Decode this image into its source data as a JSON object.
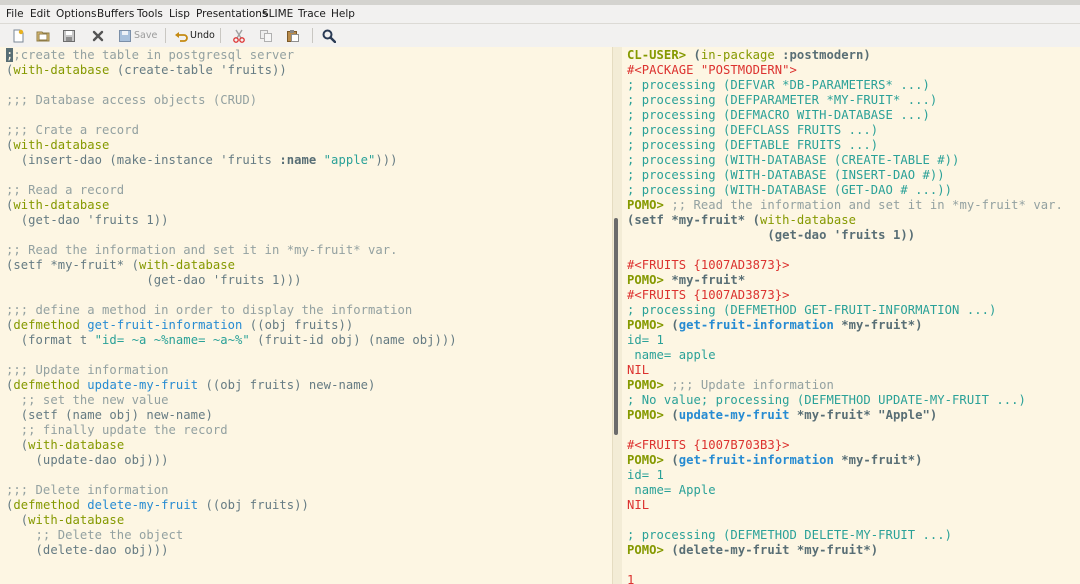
{
  "menu": [
    "File",
    "Edit",
    "Options",
    "Buffers",
    "Tools",
    "Lisp",
    "Presentations",
    "SLIME",
    "Trace",
    "Help"
  ],
  "toolbar": {
    "save_label": "Save",
    "undo_label": "Undo"
  },
  "colors": {
    "background": "#fdf6e3",
    "green": "#859900",
    "blue": "#268bd2",
    "cyan": "#2aa198",
    "red": "#dc322f",
    "comment": "#93a1a1"
  },
  "editor": {
    "lines": [
      [
        [
          "cursor",
          ";"
        ],
        [
          "cm",
          ";create the table in postgresql server"
        ]
      ],
      [
        [
          "",
          "("
        ],
        [
          "kw",
          "with-database"
        ],
        [
          "",
          " (create-table 'fruits))"
        ]
      ],
      [],
      [
        [
          "cm",
          ";;; Database access objects (CRUD)"
        ]
      ],
      [],
      [
        [
          "cm",
          ";;; Crate a record"
        ]
      ],
      [
        [
          "",
          "("
        ],
        [
          "kw",
          "with-database"
        ]
      ],
      [
        [
          "",
          "  (insert-dao (make-instance 'fruits "
        ],
        [
          "kwd",
          ":name"
        ],
        [
          "",
          " "
        ],
        [
          "str",
          "\"apple\""
        ],
        [
          "",
          ")))"
        ]
      ],
      [],
      [
        [
          "cm",
          ";; Read a record"
        ]
      ],
      [
        [
          "",
          "("
        ],
        [
          "kw",
          "with-database"
        ]
      ],
      [
        [
          "",
          "  (get-dao 'fruits 1))"
        ]
      ],
      [],
      [
        [
          "cm",
          ";; Read the information and set it in *my-fruit* var."
        ]
      ],
      [
        [
          "",
          "(setf *my-fruit* ("
        ],
        [
          "kw",
          "with-database"
        ]
      ],
      [
        [
          "",
          "                   (get-dao 'fruits 1)))"
        ]
      ],
      [],
      [
        [
          "cm",
          ";;; define a method in order to display the information"
        ]
      ],
      [
        [
          "",
          "("
        ],
        [
          "kw",
          "defmethod"
        ],
        [
          "",
          " "
        ],
        [
          "fn",
          "get-fruit-information"
        ],
        [
          "",
          " ((obj fruits))"
        ]
      ],
      [
        [
          "",
          "  (format t "
        ],
        [
          "str",
          "\"id= ~a ~%name= ~a~%\""
        ],
        [
          "",
          " (fruit-id obj) (name obj)))"
        ]
      ],
      [],
      [
        [
          "cm",
          ";;; Update information"
        ]
      ],
      [
        [
          "",
          "("
        ],
        [
          "kw",
          "defmethod"
        ],
        [
          "",
          " "
        ],
        [
          "fn",
          "update-my-fruit"
        ],
        [
          "",
          " ((obj fruits) new-name)"
        ]
      ],
      [
        [
          "cm",
          "  ;; set the new value"
        ]
      ],
      [
        [
          "",
          "  (setf (name obj) new-name)"
        ]
      ],
      [
        [
          "cm",
          "  ;; finally update the record"
        ]
      ],
      [
        [
          "",
          "  ("
        ],
        [
          "kw",
          "with-database"
        ]
      ],
      [
        [
          "",
          "    (update-dao obj)))"
        ]
      ],
      [],
      [
        [
          "cm",
          ";;; Delete information"
        ]
      ],
      [
        [
          "",
          "("
        ],
        [
          "kw",
          "defmethod"
        ],
        [
          "",
          " "
        ],
        [
          "fn",
          "delete-my-fruit"
        ],
        [
          "",
          " ((obj fruits))"
        ]
      ],
      [
        [
          "",
          "  ("
        ],
        [
          "kw",
          "with-database"
        ]
      ],
      [
        [
          "cm",
          "    ;; Delete the object"
        ]
      ],
      [
        [
          "",
          "    (delete-dao obj)))"
        ]
      ]
    ]
  },
  "repl": {
    "lines": [
      [
        [
          "prompt",
          "CL-USER> "
        ],
        [
          "inp",
          "("
        ],
        [
          "kw",
          "in-package"
        ],
        [
          "inp",
          " :postmodern)"
        ]
      ],
      [
        [
          "res",
          "#<PACKAGE \"POSTMODERN\">"
        ]
      ],
      [
        [
          "out",
          "; processing (DEFVAR *DB-PARAMETERS* ...)"
        ]
      ],
      [
        [
          "out",
          "; processing (DEFPARAMETER *MY-FRUIT* ...)"
        ]
      ],
      [
        [
          "out",
          "; processing (DEFMACRO WITH-DATABASE ...)"
        ]
      ],
      [
        [
          "out",
          "; processing (DEFCLASS FRUITS ...)"
        ]
      ],
      [
        [
          "out",
          "; processing (DEFTABLE FRUITS ...)"
        ]
      ],
      [
        [
          "out",
          "; processing (WITH-DATABASE (CREATE-TABLE #))"
        ]
      ],
      [
        [
          "out",
          "; processing (WITH-DATABASE (INSERT-DAO #))"
        ]
      ],
      [
        [
          "out",
          "; processing (WITH-DATABASE (GET-DAO # ...))"
        ]
      ],
      [
        [
          "prompt",
          "POMO> "
        ],
        [
          "cm",
          ";; Read the information and set it in *my-fruit* var."
        ]
      ],
      [
        [
          "inp",
          "(setf *my-fruit* ("
        ],
        [
          "kw",
          "with-database"
        ]
      ],
      [
        [
          "inp",
          "                   (get-dao 'fruits 1))"
        ]
      ],
      [],
      [
        [
          "res",
          "#<FRUITS {1007AD3873}>"
        ]
      ],
      [
        [
          "prompt",
          "POMO> "
        ],
        [
          "inp",
          "*my-fruit*"
        ]
      ],
      [
        [
          "res",
          "#<FRUITS {1007AD3873}>"
        ]
      ],
      [
        [
          "out",
          "; processing (DEFMETHOD GET-FRUIT-INFORMATION ...)"
        ]
      ],
      [
        [
          "prompt",
          "POMO> "
        ],
        [
          "inp",
          "("
        ],
        [
          "fnb",
          "get-fruit-information"
        ],
        [
          "inp",
          " *my-fruit*)"
        ]
      ],
      [
        [
          "out",
          "id= 1"
        ]
      ],
      [
        [
          "out",
          " name= apple"
        ]
      ],
      [
        [
          "res",
          "NIL"
        ]
      ],
      [
        [
          "prompt",
          "POMO> "
        ],
        [
          "cm",
          ";;; Update information"
        ]
      ],
      [
        [
          "out",
          "; No value; processing (DEFMETHOD UPDATE-MY-FRUIT ...)"
        ]
      ],
      [
        [
          "prompt",
          "POMO> "
        ],
        [
          "inp",
          "("
        ],
        [
          "fnb",
          "update-my-fruit"
        ],
        [
          "inp",
          " *my-fruit* \"Apple\")"
        ]
      ],
      [],
      [
        [
          "res",
          "#<FRUITS {1007B703B3}>"
        ]
      ],
      [
        [
          "prompt",
          "POMO> "
        ],
        [
          "inp",
          "("
        ],
        [
          "fnb",
          "get-fruit-information"
        ],
        [
          "inp",
          " *my-fruit*)"
        ]
      ],
      [
        [
          "out",
          "id= 1"
        ]
      ],
      [
        [
          "out",
          " name= Apple"
        ]
      ],
      [
        [
          "res",
          "NIL"
        ]
      ],
      [],
      [
        [
          "out",
          "; processing (DEFMETHOD DELETE-MY-FRUIT ...)"
        ]
      ],
      [
        [
          "prompt",
          "POMO> "
        ],
        [
          "inp",
          "(delete-my-fruit *my-fruit*)"
        ]
      ],
      [],
      [
        [
          "res",
          "1"
        ]
      ]
    ]
  }
}
